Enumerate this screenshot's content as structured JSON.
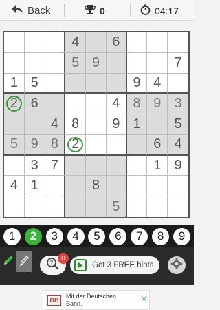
{
  "header": {
    "back_label": "Back",
    "trophy_count": "0",
    "time": "04:17"
  },
  "board": [
    [
      null,
      null,
      null,
      "4",
      null,
      "6",
      null,
      null,
      null
    ],
    [
      null,
      null,
      null,
      "5",
      "9",
      null,
      null,
      null,
      "7"
    ],
    [
      "1",
      "5",
      null,
      null,
      null,
      null,
      "9",
      "4",
      null
    ],
    [
      "2",
      "6",
      null,
      null,
      null,
      "4",
      "8",
      "9",
      "3"
    ],
    [
      null,
      null,
      "4",
      "8",
      null,
      "9",
      "1",
      null,
      "5"
    ],
    [
      "5",
      "9",
      "8",
      "2",
      null,
      null,
      null,
      "6",
      "4"
    ],
    [
      null,
      "3",
      "7",
      null,
      null,
      null,
      null,
      "1",
      "9"
    ],
    [
      "4",
      "1",
      null,
      null,
      "8",
      null,
      null,
      null,
      null
    ],
    [
      null,
      null,
      null,
      null,
      null,
      "5",
      null,
      null,
      null
    ]
  ],
  "user_entries": [
    "1-3",
    "1-4",
    "3-6",
    "3-7",
    "3-8",
    "5-0",
    "5-1",
    "5-2",
    "8-5"
  ],
  "circled_cells": [
    "3-0",
    "5-3"
  ],
  "number_pad": [
    "1",
    "2",
    "3",
    "4",
    "5",
    "6",
    "7",
    "8",
    "9"
  ],
  "selected_number": "2",
  "tools": {
    "hint_badge": "0",
    "hint_button_label": "Get 3 FREE hints"
  },
  "ad": {
    "logo": "DB",
    "line1": "Mit der Deutschen",
    "line2": "Bahn."
  },
  "colors": {
    "accent": "#3ab53a",
    "toolbar": "#2b2b2b",
    "badge": "#e0443a"
  },
  "icons": [
    "back-arrow-icon",
    "trophy-icon",
    "stopwatch-icon",
    "pencil-icon",
    "eraser-icon",
    "magnifier-icon",
    "play-video-icon",
    "gear-icon",
    "ad-close-icon"
  ]
}
